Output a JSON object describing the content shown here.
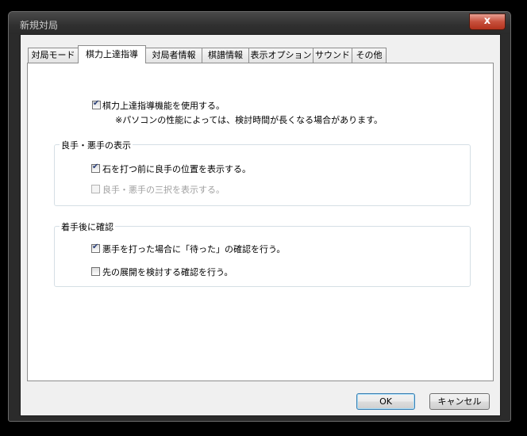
{
  "window": {
    "title": "新規対局",
    "close_glyph": "x"
  },
  "tabs": [
    {
      "label": "対局モード",
      "active": false
    },
    {
      "label": "棋力上達指導",
      "active": true
    },
    {
      "label": "対局者情報",
      "active": false
    },
    {
      "label": "棋譜情報",
      "active": false
    },
    {
      "label": "表示オプション",
      "active": false
    },
    {
      "label": "サウンド",
      "active": false
    },
    {
      "label": "その他",
      "active": false
    }
  ],
  "main": {
    "use_guidance": {
      "label": "棋力上達指導機能を使用する。",
      "checked": true
    },
    "note": "※パソコンの性能によっては、検討時間が長くなる場合があります。"
  },
  "group_good_bad": {
    "title": "良手・悪手の表示",
    "show_before": {
      "label": "石を打つ前に良手の位置を表示する。",
      "checked": true
    },
    "three_choice": {
      "label": "良手・悪手の三択を表示する。",
      "checked": false,
      "disabled": true
    }
  },
  "group_confirm": {
    "title": "着手後に確認",
    "wait_confirm": {
      "label": "悪手を打った場合に「待った」の確認を行う。",
      "checked": true
    },
    "future_confirm": {
      "label": "先の展開を検討する確認を行う。",
      "checked": false
    }
  },
  "buttons": {
    "ok": "OK",
    "cancel": "キャンセル"
  }
}
